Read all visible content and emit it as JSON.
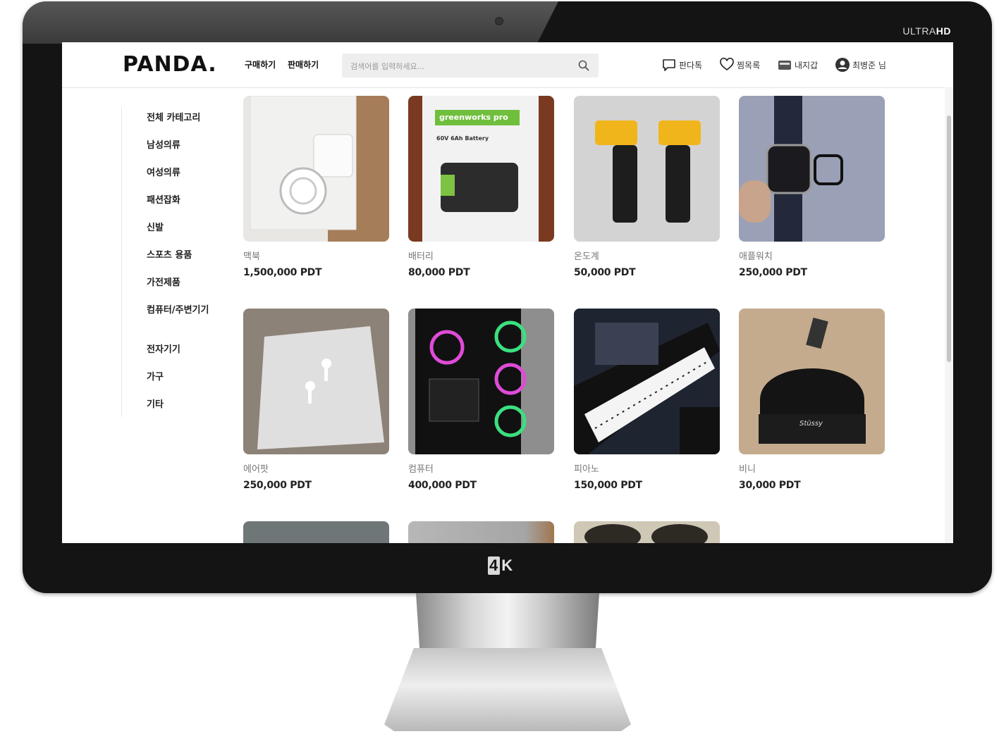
{
  "monitor": {
    "brand_badge_ultra": "ULTRA",
    "brand_badge_hd": "HD",
    "badge_4k_box": "4",
    "badge_4k_rest": "K"
  },
  "header": {
    "logo": "PANDA.",
    "nav": {
      "buy": "구매하기",
      "sell": "판매하기"
    },
    "search": {
      "placeholder": "검색어를 입력하세요...",
      "value": ""
    },
    "actions": {
      "chat": "판다톡",
      "wishlist": "찜목록",
      "wallet": "내지갑",
      "user": "최병준 님"
    }
  },
  "sidebar": {
    "items": [
      {
        "label": "전체 카테고리"
      },
      {
        "label": "남성의류"
      },
      {
        "label": "여성의류"
      },
      {
        "label": "패션잡화"
      },
      {
        "label": "신발"
      },
      {
        "label": "스포츠 용품"
      },
      {
        "label": "가전제품"
      },
      {
        "label": "컴퓨터/주변기기"
      },
      {
        "label": "전자기기"
      },
      {
        "label": "가구"
      },
      {
        "label": "기타"
      }
    ]
  },
  "products": [
    {
      "name": "맥북",
      "price": "1,500,000 PDT",
      "thumb_color": "#d6d3ce"
    },
    {
      "name": "배터리",
      "price": "80,000 PDT",
      "thumb_color": "#7a3a22",
      "thumb_text": "greenworks pro",
      "thumb_subtext": "60V 6Ah Battery"
    },
    {
      "name": "온도계",
      "price": "50,000 PDT",
      "thumb_color": "#cfcfcf"
    },
    {
      "name": "애플워치",
      "price": "250,000 PDT",
      "thumb_color": "#9aa1b6"
    },
    {
      "name": "에어팟",
      "price": "250,000 PDT",
      "thumb_color": "#8d8277"
    },
    {
      "name": "컴퓨터",
      "price": "400,000 PDT",
      "thumb_color": "#1d1d22"
    },
    {
      "name": "피아노",
      "price": "150,000 PDT",
      "thumb_color": "#1e2430"
    },
    {
      "name": "비니",
      "price": "30,000 PDT",
      "thumb_color": "#b59a7b",
      "thumb_text": "Stüssy"
    },
    {
      "name": "",
      "price": "",
      "thumb_color": "#6f7678"
    },
    {
      "name": "",
      "price": "",
      "thumb_color": "#a9a9a9"
    },
    {
      "name": "",
      "price": "",
      "thumb_color": "#4a4432"
    }
  ]
}
